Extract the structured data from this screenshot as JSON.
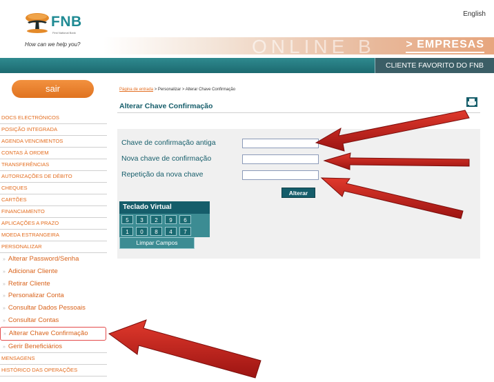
{
  "header": {
    "lang_link": "English",
    "logo_text": "FNB",
    "logo_subtext": "First National Bank",
    "tagline": "How can we help you?",
    "banner_ghost_text": "ONLINE B",
    "section_title": "> EMPRESAS"
  },
  "navbar": {
    "favorite_client": "CLIENTE FAVORITO DO FNB"
  },
  "sidebar": {
    "logout": "sair",
    "items": [
      {
        "label": "DOCS ELECTRÓNICOS"
      },
      {
        "label": "POSIÇÃO INTEGRADA"
      },
      {
        "label": "AGENDA VENCIMENTOS"
      },
      {
        "label": "CONTAS À ORDEM"
      },
      {
        "label": "TRANSFERÊNCIAS"
      },
      {
        "label": "AUTORIZAÇÕES DE DÉBITO"
      },
      {
        "label": "CHEQUES"
      },
      {
        "label": "CARTÕES"
      },
      {
        "label": "FINANCIAMENTO"
      },
      {
        "label": "APLICAÇÕES A PRAZO"
      },
      {
        "label": "MOEDA ESTRANGEIRA"
      }
    ],
    "personalizar_label": "PERSONALIZAR",
    "sub_items": [
      {
        "label": "Alterar Password/Senha"
      },
      {
        "label": "Adicionar Cliente"
      },
      {
        "label": "Retirar Cliente"
      },
      {
        "label": "Personalizar Conta"
      },
      {
        "label": "Consultar Dados Pessoais"
      },
      {
        "label": "Consultar Contas"
      },
      {
        "label": "Alterar Chave Confirmação"
      },
      {
        "label": "Gerir Beneficiários"
      }
    ],
    "bottom_items": [
      {
        "label": "MENSAGENS"
      },
      {
        "label": "HISTÓRICO DAS OPERAÇÕES"
      }
    ]
  },
  "breadcrumb": {
    "home": "Página de entrada",
    "rest": " > Personalizar > Alterar Chave Confirmação"
  },
  "page": {
    "title": "Alterar Chave Confirmação"
  },
  "form": {
    "old_key_label": "Chave de confirmação antiga",
    "new_key_label": "Nova chave de confirmação",
    "repeat_key_label": "Repetição da nova chave",
    "old_key_value": "",
    "new_key_value": "",
    "repeat_key_value": "",
    "submit_label": "Alterar"
  },
  "keypad": {
    "title": "Teclado Virtual",
    "row1": [
      "5",
      "3",
      "2",
      "9",
      "6"
    ],
    "row2": [
      "1",
      "0",
      "8",
      "4",
      "7"
    ],
    "clear_label": "Limpar Campos"
  },
  "colors": {
    "brand_teal": "#155d6a",
    "accent_orange": "#e36c1e",
    "annotation_red": "#c8201c"
  }
}
